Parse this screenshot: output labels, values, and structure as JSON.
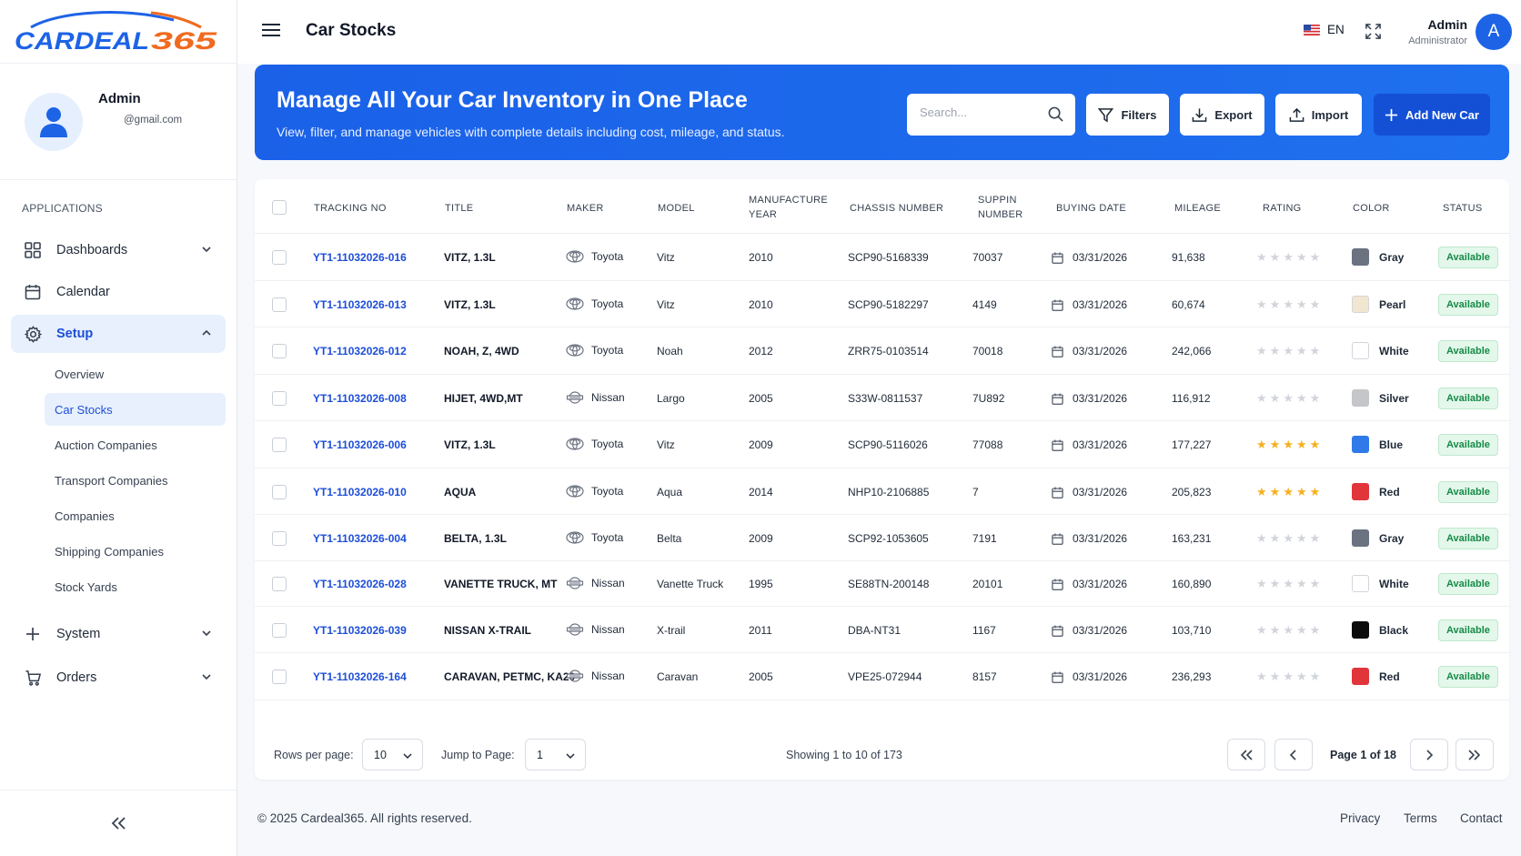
{
  "brand": {
    "logo_text": "CARDEAL365",
    "accent": "#1d63e6",
    "logo_orange": "#f06a1f"
  },
  "profile": {
    "name": "Admin",
    "email": "@gmail.com"
  },
  "sidebar": {
    "section_title": "APPLICATIONS",
    "items": [
      {
        "label": "Dashboards",
        "icon": "grid-icon",
        "expandable": true
      },
      {
        "label": "Calendar",
        "icon": "calendar-icon",
        "expandable": false
      },
      {
        "label": "Setup",
        "icon": "gear-icon",
        "expandable": true,
        "expanded": true
      }
    ],
    "setup_children": [
      "Overview",
      "Car Stocks",
      "Auction Companies",
      "Transport Companies",
      "Companies",
      "Shipping Companies",
      "Stock Yards"
    ],
    "active_child": "Car Stocks",
    "lower_items": [
      {
        "label": "System",
        "icon": "plus-icon"
      },
      {
        "label": "Orders",
        "icon": "cart-icon"
      }
    ]
  },
  "topbar": {
    "title": "Car Stocks",
    "language": "EN",
    "user_name": "Admin",
    "user_role": "Administrator",
    "avatar_letter": "A"
  },
  "banner": {
    "title": "Manage All Your Car Inventory in One Place",
    "subtitle": "View, filter, and manage vehicles with complete details including cost, mileage, and status.",
    "search_placeholder": "Search...",
    "filters_label": "Filters",
    "export_label": "Export",
    "import_label": "Import",
    "add_label": "Add New Car"
  },
  "table": {
    "headers": {
      "tracking": "TRACKING NO",
      "title": "TITLE",
      "maker": "MAKER",
      "model": "MODEL",
      "year_1": "MANUFACTURE",
      "year_2": "YEAR",
      "chassis": "CHASSIS NUMBER",
      "suppin_1": "SUPPIN",
      "suppin_2": "NUMBER",
      "buying_date": "BUYING DATE",
      "mileage": "MILEAGE",
      "rating": "RATING",
      "color": "COLOR",
      "status": "STATUS"
    },
    "rows": [
      {
        "tracking": "YT1-11032026-016",
        "title": "VITZ, 1.3L",
        "maker": "Toyota",
        "model": "Vitz",
        "year": "2010",
        "chassis": "SCP90-5168339",
        "suppin": "70037",
        "date": "03/31/2026",
        "mileage": "91,638",
        "rating": 0,
        "color": "Gray",
        "color_hex": "#6b7280",
        "status": "Available"
      },
      {
        "tracking": "YT1-11032026-013",
        "title": "VITZ, 1.3L",
        "maker": "Toyota",
        "model": "Vitz",
        "year": "2010",
        "chassis": "SCP90-5182297",
        "suppin": "4149",
        "date": "03/31/2026",
        "mileage": "60,674",
        "rating": 0,
        "color": "Pearl",
        "color_hex": "#f1e6cf",
        "status": "Available"
      },
      {
        "tracking": "YT1-11032026-012",
        "title": "NOAH, Z, 4WD",
        "maker": "Toyota",
        "model": "Noah",
        "year": "2012",
        "chassis": "ZRR75-0103514",
        "suppin": "70018",
        "date": "03/31/2026",
        "mileage": "242,066",
        "rating": 0,
        "color": "White",
        "color_hex": "#ffffff",
        "status": "Available"
      },
      {
        "tracking": "YT1-11032026-008",
        "title": "HIJET, 4WD,MT",
        "maker": "Nissan",
        "model": "Largo",
        "year": "2005",
        "chassis": "S33W-0811537",
        "suppin": "7U892",
        "date": "03/31/2026",
        "mileage": "116,912",
        "rating": 0,
        "color": "Silver",
        "color_hex": "#c4c6ca",
        "status": "Available"
      },
      {
        "tracking": "YT1-11032026-006",
        "title": "VITZ, 1.3L",
        "maker": "Toyota",
        "model": "Vitz",
        "year": "2009",
        "chassis": "SCP90-5116026",
        "suppin": "77088",
        "date": "03/31/2026",
        "mileage": "177,227",
        "rating": 5,
        "color": "Blue",
        "color_hex": "#2f7ae8",
        "status": "Available"
      },
      {
        "tracking": "YT1-11032026-010",
        "title": "AQUA",
        "maker": "Toyota",
        "model": "Aqua",
        "year": "2014",
        "chassis": "NHP10-2106885",
        "suppin": "7",
        "date": "03/31/2026",
        "mileage": "205,823",
        "rating": 5,
        "color": "Red",
        "color_hex": "#e0353b",
        "status": "Available"
      },
      {
        "tracking": "YT1-11032026-004",
        "title": "BELTA, 1.3L",
        "maker": "Toyota",
        "model": "Belta",
        "year": "2009",
        "chassis": "SCP92-1053605",
        "suppin": "7191",
        "date": "03/31/2026",
        "mileage": "163,231",
        "rating": 0,
        "color": "Gray",
        "color_hex": "#6b7280",
        "status": "Available"
      },
      {
        "tracking": "YT1-11032026-028",
        "title": "VANETTE TRUCK, MT",
        "maker": "Nissan",
        "model": "Vanette Truck",
        "year": "1995",
        "chassis": "SE88TN-200148",
        "suppin": "20101",
        "date": "03/31/2026",
        "mileage": "160,890",
        "rating": 0,
        "color": "White",
        "color_hex": "#ffffff",
        "status": "Available"
      },
      {
        "tracking": "YT1-11032026-039",
        "title": "NISSAN X-TRAIL",
        "maker": "Nissan",
        "model": "X-trail",
        "year": "2011",
        "chassis": "DBA-NT31",
        "suppin": "1167",
        "date": "03/31/2026",
        "mileage": "103,710",
        "rating": 0,
        "color": "Black",
        "color_hex": "#0b0b0b",
        "status": "Available"
      },
      {
        "tracking": "YT1-11032026-164",
        "title": "CARAVAN, PETMC, KA20",
        "maker": "Nissan",
        "model": "Caravan",
        "year": "2005",
        "chassis": "VPE25-072944",
        "suppin": "8157",
        "date": "03/31/2026",
        "mileage": "236,293",
        "rating": 0,
        "color": "Red",
        "color_hex": "#e0353b",
        "status": "Available"
      }
    ],
    "star_on_color": "#f6b01e",
    "star_off_color": "#d1d5db"
  },
  "pagination": {
    "rows_per_page_label": "Rows per page:",
    "rows_per_page": "10",
    "jump_label": "Jump to Page:",
    "jump_value": "1",
    "showing": "Showing 1 to 10 of 173",
    "page_info": "Page 1 of 18"
  },
  "footer": {
    "copyright": "© 2025 Cardeal365. All rights reserved.",
    "links": [
      "Privacy",
      "Terms",
      "Contact"
    ]
  }
}
